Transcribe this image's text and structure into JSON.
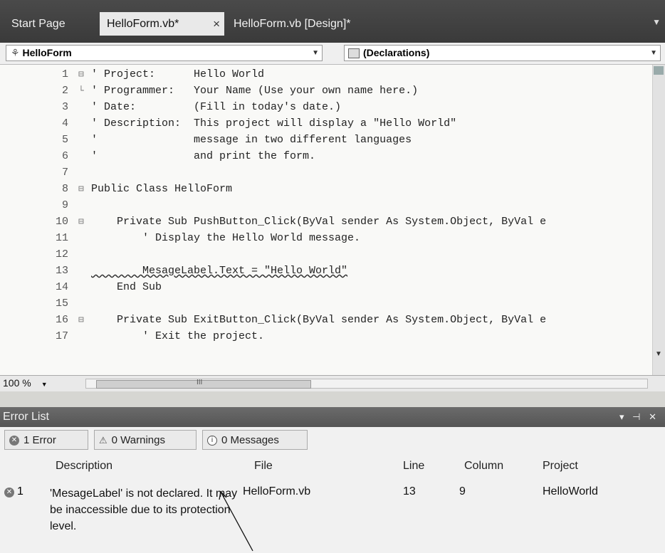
{
  "tabs": [
    {
      "label": "Start Page"
    },
    {
      "label": "HelloForm.vb*",
      "close": "×"
    },
    {
      "label": "HelloForm.vb [Design]*"
    }
  ],
  "navbar": {
    "class_combo": "HelloForm",
    "class_icon": "class-icon",
    "member_combo": "(Declarations)"
  },
  "editor": {
    "lines": [
      {
        "num": "1",
        "fold": "⊟",
        "text": "' Project:      Hello World"
      },
      {
        "num": "2",
        "fold": "└",
        "text": "' Programmer:   Your Name (Use your own name here.)"
      },
      {
        "num": "3",
        "fold": "",
        "text": "' Date:         (Fill in today's date.)"
      },
      {
        "num": "4",
        "fold": "",
        "text": "' Description:  This project will display a \"Hello World\""
      },
      {
        "num": "5",
        "fold": "",
        "text": "'               message in two different languages"
      },
      {
        "num": "6",
        "fold": "",
        "text": "'               and print the form."
      },
      {
        "num": "7",
        "fold": "",
        "text": ""
      },
      {
        "num": "8",
        "fold": "⊟",
        "text": "Public Class HelloForm"
      },
      {
        "num": "9",
        "fold": "",
        "text": ""
      },
      {
        "num": "10",
        "fold": "⊟",
        "text": "    Private Sub PushButton_Click(ByVal sender As System.Object, ByVal e"
      },
      {
        "num": "11",
        "fold": "",
        "text": "        ' Display the Hello World message."
      },
      {
        "num": "12",
        "fold": "",
        "text": ""
      },
      {
        "num": "13",
        "fold": "",
        "text": "        MesageLabel.Text = \"Hello World\""
      },
      {
        "num": "14",
        "fold": "",
        "text": "    End Sub"
      },
      {
        "num": "15",
        "fold": "",
        "text": ""
      },
      {
        "num": "16",
        "fold": "⊟",
        "text": "    Private Sub ExitButton_Click(ByVal sender As System.Object, ByVal e"
      },
      {
        "num": "17",
        "fold": "",
        "text": "        ' Exit the project."
      }
    ]
  },
  "zoom": {
    "value": "100 %",
    "hscroll_glyph": "III"
  },
  "error_list": {
    "title": "Error List",
    "errors_btn": "1 Error",
    "warnings_btn": "0 Warnings",
    "messages_btn": "0 Messages",
    "columns": [
      "Description",
      "File",
      "Line",
      "Column",
      "Project"
    ],
    "rows": [
      {
        "num": "1",
        "description": "'MesageLabel' is not declared. It may be inaccessible due to its protection level.",
        "file": "HelloForm.vb",
        "line": "13",
        "column": "9",
        "project": "HelloWorld"
      }
    ]
  }
}
